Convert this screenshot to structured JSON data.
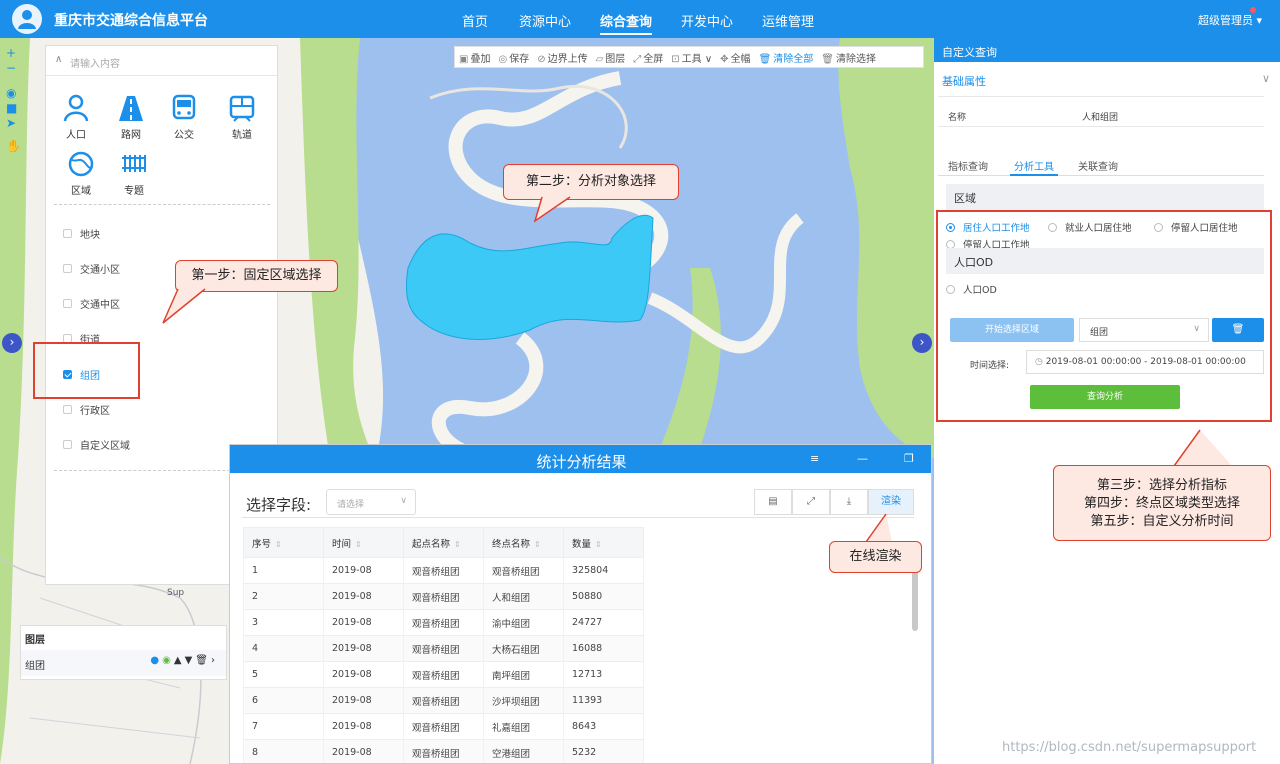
{
  "header": {
    "title": "重庆市交通综合信息平台",
    "nav": [
      "首页",
      "资源中心",
      "综合查询",
      "开发中心",
      "运维管理"
    ],
    "active_nav": "综合查询",
    "user": "超级管理员"
  },
  "map_toolbar": {
    "items": [
      "叠加",
      "保存",
      "边界上传",
      "图层",
      "全屏",
      "工具",
      "全幅",
      "清除全部",
      "清除选择"
    ]
  },
  "map": {
    "tools": [
      "+",
      "−"
    ],
    "collapse_left": "›",
    "collapse_right": "›",
    "map_label": "Sup"
  },
  "left_panel": {
    "search_placeholder": "请输入内容",
    "categories": [
      "人口",
      "路网",
      "公交",
      "轨道",
      "区域",
      "专题"
    ],
    "options": [
      "地块",
      "交通小区",
      "交通中区",
      "街道",
      "组团",
      "行政区",
      "自定义区域"
    ],
    "checked_option": "组团"
  },
  "layers": {
    "title": "图层",
    "row": "组团"
  },
  "callouts": {
    "step1": "第一步：固定区域选择",
    "step2": "第二步：分析对象选择",
    "step345": [
      "第三步：选择分析指标",
      "第四步：终点区域类型选择",
      "第五步：自定义分析时间"
    ],
    "render": "在线渲染"
  },
  "right_panel": {
    "title": "自定义查询",
    "section": "基础属性",
    "name_label": "名称",
    "name_value": "人和组团",
    "tabs": [
      "指标查询",
      "分析工具",
      "关联查询"
    ],
    "active_tab": "分析工具",
    "region_label": "区域",
    "radios": [
      "居住人口工作地",
      "就业人口居住地",
      "停留人口居住地",
      "停留人口工作地"
    ],
    "selected_radio": "居住人口工作地",
    "od_label": "人口OD",
    "od_radio": "人口OD",
    "start_button": "开始选择区域",
    "select_value": "组团",
    "delete_icon": "trash-icon",
    "time_label": "时间选择:",
    "time_range": "2019-08-01 00:00:00  -  2019-08-01 00:00:00",
    "query_button": "查询分析"
  },
  "modal": {
    "title": "统计分析结果",
    "field_label": "选择字段:",
    "field_placeholder": "请选择",
    "render_button": "渲染",
    "columns": [
      "序号",
      "时间",
      "起点名称",
      "终点名称",
      "数量"
    ],
    "rows": [
      [
        "1",
        "2019-08",
        "观音桥组团",
        "观音桥组团",
        "325804"
      ],
      [
        "2",
        "2019-08",
        "观音桥组团",
        "人和组团",
        "50880"
      ],
      [
        "3",
        "2019-08",
        "观音桥组团",
        "渝中组团",
        "24727"
      ],
      [
        "4",
        "2019-08",
        "观音桥组团",
        "大杨石组团",
        "16088"
      ],
      [
        "5",
        "2019-08",
        "观音桥组团",
        "南坪组团",
        "12713"
      ],
      [
        "6",
        "2019-08",
        "观音桥组团",
        "沙坪坝组团",
        "11393"
      ],
      [
        "7",
        "2019-08",
        "观音桥组团",
        "礼嘉组团",
        "8643"
      ],
      [
        "8",
        "2019-08",
        "观音桥组团",
        "空港组团",
        "5232"
      ]
    ]
  },
  "watermark": "https://blog.csdn.net/supermapsupport",
  "colors": {
    "primary": "#1b8fe9",
    "green_button": "#5cbe3a",
    "highlight_region": "#3cc9f5",
    "water": "#9ec0ee",
    "vegetation": "#b9dd8e",
    "callout_border": "#e0412e"
  }
}
